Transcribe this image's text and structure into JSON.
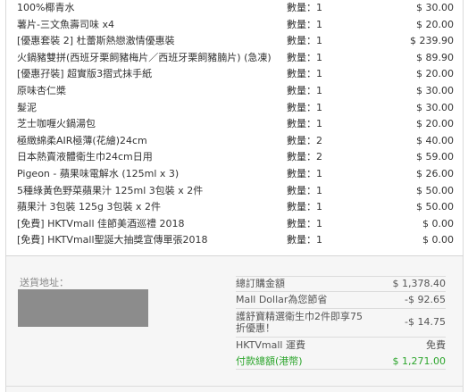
{
  "items": [
    {
      "name": "100%椰青水",
      "qty": "數量：1",
      "price": "$ 30.00"
    },
    {
      "name": "薯片-三文魚壽司味 x4",
      "qty": "數量：1",
      "price": "$ 20.00"
    },
    {
      "name": "[優惠套裝 2] 杜蕾斯熱戀激情優惠裝",
      "qty": "數量：1",
      "price": "$ 239.90"
    },
    {
      "name": "火鍋豬雙拼(西班牙栗飼豬梅片／西班牙栗飼豬腩片) (急凍)",
      "qty": "數量：1",
      "price": "$ 89.90"
    },
    {
      "name": "[優惠孖裝] 超實版3摺式抹手紙",
      "qty": "數量：1",
      "price": "$ 20.00"
    },
    {
      "name": "原味杏仁槳",
      "qty": "數量：1",
      "price": "$ 30.00"
    },
    {
      "name": "髮泥",
      "qty": "數量：1",
      "price": "$ 30.00"
    },
    {
      "name": "芝士咖喱火鍋湯包",
      "qty": "數量：1",
      "price": "$ 20.00"
    },
    {
      "name": "極緻綿柔AIR極薄(花繪)24cm",
      "qty": "數量：2",
      "price": "$ 40.00"
    },
    {
      "name": "日本熱賣液體衛生巾24cm日用",
      "qty": "數量：2",
      "price": "$ 59.00"
    },
    {
      "name": "Pigeon - 蘋果味電解水 (125ml x 3)",
      "qty": "數量：1",
      "price": "$ 26.00"
    },
    {
      "name": "5種綠黃色野菜蘋果汁 125ml 3包裝 x 2件",
      "qty": "數量：1",
      "price": "$ 50.00"
    },
    {
      "name": "蘋果汁 3包裝 125g 3包裝 x 2件",
      "qty": "數量：1",
      "price": "$ 50.00"
    },
    {
      "name": "[免費] HKTVmall 佳節美酒巡禮 2018",
      "qty": "數量：1",
      "price": "$ 0.00"
    },
    {
      "name": "[免費] HKTVmall聖誕大抽獎宣傳單張2018",
      "qty": "數量：1",
      "price": "$ 0.00"
    }
  ],
  "address": {
    "label": "送貨地址："
  },
  "summary": {
    "total_label": "總訂購金額",
    "total_value": "$ 1,378.40",
    "mall_dollar_label": "Mall Dollar為您節省",
    "mall_dollar_value": "-$ 92.65",
    "promo_label": "護舒寶精選衛生巾2件即享75折優惠！",
    "promo_value": "-$ 14.75",
    "shipping_label": "HKTVmall 運費",
    "shipping_value": "免費",
    "paid_label": "付款總額(港幣)",
    "paid_value": "$ 1,271.00"
  },
  "colors": {
    "accent_green": "#2ca52c"
  }
}
